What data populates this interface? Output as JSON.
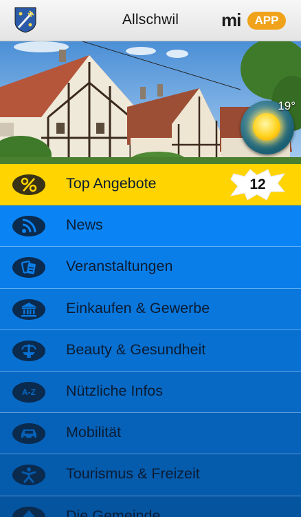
{
  "header": {
    "title": "Allschwil",
    "brand_left": "mi",
    "brand_right": "APP",
    "crest_icon": "coat-of-arms-icon"
  },
  "hero": {
    "temperature": "19°",
    "weather_icon": "sun-icon"
  },
  "menu": {
    "items": [
      {
        "label": "Top Angebote",
        "icon": "percent-icon",
        "badge": "12"
      },
      {
        "label": "News",
        "icon": "rss-icon"
      },
      {
        "label": "Veranstaltungen",
        "icon": "tickets-icon"
      },
      {
        "label": "Einkaufen & Gewerbe",
        "icon": "building-icon"
      },
      {
        "label": "Beauty & Gesundheit",
        "icon": "fountain-icon"
      },
      {
        "label": "Nützliche Infos",
        "icon": "a-z-icon",
        "icon_text": "A-Z"
      },
      {
        "label": "Mobilität",
        "icon": "car-icon"
      },
      {
        "label": "Tourismus & Freizeit",
        "icon": "leisure-person-icon"
      },
      {
        "label": "Die Gemeinde",
        "icon": "arrow-up-icon"
      }
    ]
  },
  "colors": {
    "top_row": "#ffd400",
    "brand_pill": "#f0a21a",
    "text_dark": "#0b1c33"
  }
}
